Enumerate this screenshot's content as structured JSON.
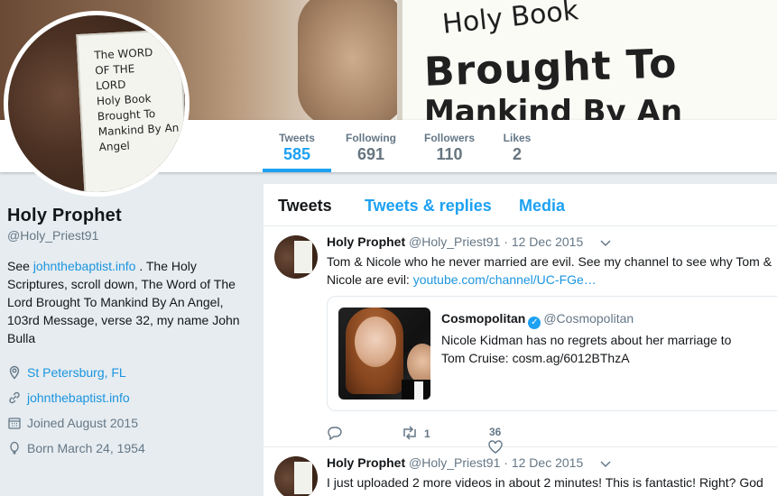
{
  "banner": {
    "sign_line1": "Holy  Book",
    "sign_line2": "Brought To",
    "sign_line3": "Mankind By An"
  },
  "avatar": {
    "paper_text": "The WORD\nOF THE\nLORD\nHoly Book\nBrought To\nMankind By An\nAngel"
  },
  "nav": {
    "stats": [
      {
        "label": "Tweets",
        "value": "585"
      },
      {
        "label": "Following",
        "value": "691"
      },
      {
        "label": "Followers",
        "value": "110"
      },
      {
        "label": "Likes",
        "value": "2"
      }
    ]
  },
  "profile": {
    "name": "Holy Prophet",
    "handle": "@Holy_Priest91",
    "bio_prefix": "See ",
    "bio_link": "johnthebaptist.info",
    "bio_rest": " . The Holy Scriptures, scroll down, The Word of The Lord Brought To Mankind By An Angel, 103rd Message, verse 32, my name John Bulla",
    "location": "St Petersburg, FL",
    "website": "johnthebaptist.info",
    "joined": "Joined August 2015",
    "born": "Born March 24, 1954"
  },
  "tabs": [
    {
      "label": "Tweets"
    },
    {
      "label": "Tweets & replies"
    },
    {
      "label": "Media"
    }
  ],
  "tweets": [
    {
      "name": "Holy Prophet",
      "handle": "@Holy_Priest91",
      "date": "· 12 Dec 2015",
      "text": "Tom & Nicole who he never married are evil. See my channel to see why Tom & Nicole are evil: ",
      "link": "youtube.com/channel/UC-FGe…",
      "card": {
        "name": "Cosmopolitan",
        "handle": "@Cosmopolitan",
        "text": "Nicole Kidman has no regrets about her marriage to Tom Cruise:  cosm.ag/6012BThzA"
      },
      "retweets": "1",
      "likes": "36"
    },
    {
      "name": "Holy Prophet",
      "handle": "@Holy_Priest91",
      "date": "· 12 Dec 2015",
      "text": "I just uploaded 2 more videos in about 2 minutes! This is fantastic! Right? God"
    }
  ],
  "colors": {
    "accent": "#1da1f2",
    "link": "#1b95e0",
    "muted": "#657786",
    "background": "#e6ecf0"
  }
}
